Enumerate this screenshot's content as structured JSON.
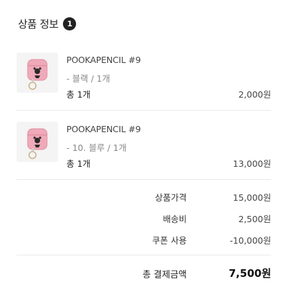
{
  "section": {
    "title": "상품 정보",
    "count": "1"
  },
  "items": [
    {
      "name": "POOKAPENCIL #9",
      "option": "- 블랙 / 1개",
      "quantity": "총 1개",
      "price": "2,000원",
      "thumbnail_icon": "airpods-case-pink-thumbnail"
    },
    {
      "name": "POOKAPENCIL #9",
      "option": "- 10. 블루 / 1개",
      "quantity": "총 1개",
      "price": "13,000원",
      "thumbnail_icon": "airpods-case-pink-thumbnail"
    }
  ],
  "summary": {
    "subtotal_label": "상품가격",
    "subtotal_value": "15,000원",
    "shipping_label": "배송비",
    "shipping_value": "2,500원",
    "coupon_label": "쿠폰 사용",
    "coupon_value": "-10,000원",
    "total_label": "총 결제금액",
    "total_value": "7,500원"
  },
  "colors": {
    "badge": "#222222",
    "case_pink": "#f0a9b8",
    "divider": "#e9e9e9"
  }
}
